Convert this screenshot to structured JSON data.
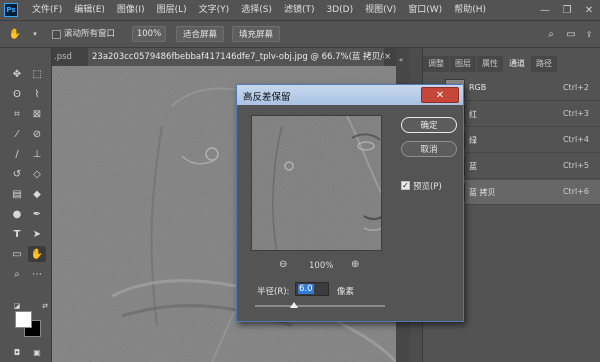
{
  "menu": {
    "logo": "Ps",
    "items": [
      "文件(F)",
      "编辑(E)",
      "图像(I)",
      "图层(L)",
      "文字(Y)",
      "选择(S)",
      "滤镜(T)",
      "3D(D)",
      "视图(V)",
      "窗口(W)",
      "帮助(H)"
    ]
  },
  "window_controls": {
    "minimize": "—",
    "maximize": "❐",
    "close": "✕"
  },
  "options_bar": {
    "scroll_all_label": "滚动所有窗口",
    "zoom_value": "100%",
    "fit_screen_label": "适合屏幕",
    "fill_screen_label": "填充屏幕"
  },
  "document_tabs": [
    {
      "label": ".psd",
      "active": false
    },
    {
      "label": "23a203cc0579486fbebbaf417146dfe7_tplv-obj.jpg @ 66.7%(蓝 拷贝/8) *",
      "active": true
    }
  ],
  "tab_close": "×",
  "panel": {
    "tabs": [
      {
        "label": "调整",
        "active": false
      },
      {
        "label": "图层",
        "active": false
      },
      {
        "label": "属性",
        "active": false
      },
      {
        "label": "通道",
        "active": true
      },
      {
        "label": "路径",
        "active": false
      }
    ],
    "channels": [
      {
        "name": "RGB",
        "shortcut": "Ctrl+2",
        "selected": false
      },
      {
        "name": "红",
        "shortcut": "Ctrl+3",
        "selected": false
      },
      {
        "name": "绿",
        "shortcut": "Ctrl+4",
        "selected": false
      },
      {
        "name": "蓝",
        "shortcut": "Ctrl+5",
        "selected": false
      },
      {
        "name": "蓝 拷贝",
        "shortcut": "Ctrl+6",
        "selected": true
      }
    ]
  },
  "dialog": {
    "title": "高反差保留",
    "close": "✕",
    "ok_label": "确定",
    "cancel_label": "取消",
    "preview_label": "预览(P)",
    "preview_checked": "✓",
    "zoom_out": "⊖",
    "zoom_in": "⊕",
    "zoom_level": "100%",
    "radius_label": "半径(R):",
    "radius_value": "6.0",
    "radius_unit": "像素",
    "radius_slider_fraction": 0.3
  },
  "colors": {
    "foreground": "#ffffff",
    "background": "#000000"
  }
}
